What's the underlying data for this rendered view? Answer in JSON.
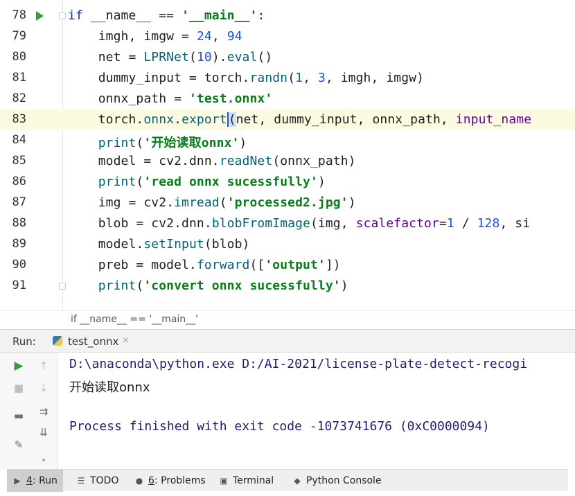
{
  "editor": {
    "lines": [
      {
        "num": "78",
        "has_run_arrow": true,
        "current": false
      },
      {
        "num": "79",
        "current": false
      },
      {
        "num": "80",
        "current": false
      },
      {
        "num": "81",
        "current": false
      },
      {
        "num": "82",
        "current": false
      },
      {
        "num": "83",
        "current": true
      },
      {
        "num": "84",
        "current": false
      },
      {
        "num": "85",
        "current": false
      },
      {
        "num": "86",
        "current": false
      },
      {
        "num": "87",
        "current": false
      },
      {
        "num": "88",
        "current": false
      },
      {
        "num": "89",
        "current": false
      },
      {
        "num": "90",
        "current": false
      },
      {
        "num": "91",
        "current": false
      }
    ],
    "tokens": {
      "l78": {
        "kw": "if",
        "a": " __name__ == ",
        "s": "'__main__'",
        "b": ":"
      },
      "l79": {
        "a": "    imgh, imgw = ",
        "n1": "24",
        "b": ", ",
        "n2": "94"
      },
      "l80": {
        "a": "    net = ",
        "f": "LPRNet",
        "b": "(",
        "n": "10",
        "c": ").",
        "m": "eval",
        "d": "()"
      },
      "l81": {
        "a": "    dummy_input = torch.",
        "m": "randn",
        "b": "(",
        "n1": "1",
        "c": ", ",
        "n2": "3",
        "d": ", imgh, imgw)"
      },
      "l82": {
        "a": "    onnx_path = ",
        "s": "'test.onnx'"
      },
      "l83": {
        "a": "    torch.",
        "m1": "onnx",
        "b": ".",
        "m2": "export",
        "caret": "(",
        "c": "net, dummy_input, onnx_path, ",
        "p": "input_name"
      },
      "l84": {
        "a": "    ",
        "bi": "print",
        "b": "(",
        "s": "'开始读取onnx'",
        "c": ")"
      },
      "l85": {
        "a": "    model = cv2.dnn.",
        "m": "readNet",
        "b": "(onnx_path)"
      },
      "l86": {
        "a": "    ",
        "bi": "print",
        "b": "(",
        "s": "'read onnx sucessfully'",
        "c": ")"
      },
      "l87": {
        "a": "    img = cv2.",
        "m": "imread",
        "b": "(",
        "s": "'processed2.jpg'",
        "c": ")"
      },
      "l88": {
        "a": "    blob = cv2.dnn.",
        "m": "blobFromImage",
        "b": "(img, ",
        "p": "scalefactor",
        "c": "=",
        "n1": "1",
        "d": " / ",
        "n2": "128",
        "e": ", si"
      },
      "l89": {
        "a": "    model.",
        "m": "setInput",
        "b": "(blob)"
      },
      "l90": {
        "a": "    preb = model.",
        "m": "forward",
        "b": "([",
        "s": "'output'",
        "c": "])"
      },
      "l91": {
        "a": "    ",
        "bi": "print",
        "b": "(",
        "s": "'convert onnx sucessfully'",
        "c": ")"
      }
    },
    "breadcrumb": "if __name__ == '__main__'"
  },
  "run_panel": {
    "label": "Run:",
    "tab_name": "test_onnx",
    "tab_close": "×",
    "console_lines": [
      "D:\\anaconda\\python.exe D:/AI-2021/license-plate-detect-recogi",
      "开始读取onnx",
      "",
      "Process finished with exit code -1073741676 (0xC0000094)"
    ]
  },
  "bottom_bar": {
    "items": [
      {
        "prefix": "4",
        "label": ": Run",
        "icon": "play-icon",
        "active": true
      },
      {
        "label": "TODO",
        "icon": "list-icon"
      },
      {
        "prefix": "6",
        "label": ": Problems",
        "icon": "info-icon"
      },
      {
        "label": "Terminal",
        "icon": "terminal-icon"
      },
      {
        "label": "Python Console",
        "icon": "python-icon"
      }
    ]
  }
}
